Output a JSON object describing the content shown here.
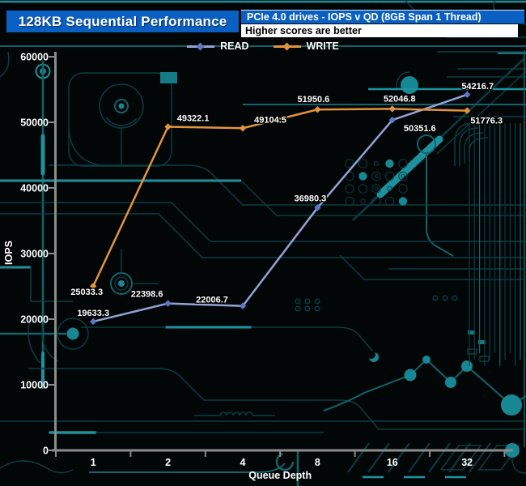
{
  "header": {
    "title": "128KB Sequential Performance",
    "subtitle": "PCIe 4.0 drives - IOPS v QD (8GB Span 1 Thread)",
    "note": "Higher scores are better"
  },
  "colors": {
    "header_bg": "#0a60c2",
    "note_bg": "#ffffff",
    "axis": "#8c8c8c",
    "tick_text": "#ffffff",
    "label_text": "#ffffff",
    "circuit_bright": "#1d929c",
    "circuit_mid": "#11646d",
    "circuit_dim": "#0a3d45",
    "background": "#030606"
  },
  "chart_data": {
    "type": "line",
    "title": "128KB Sequential Performance",
    "categories": [
      "1",
      "2",
      "4",
      "8",
      "16",
      "32"
    ],
    "xlabel": "Queue Depth",
    "ylabel": "IOPS",
    "ylim": [
      0,
      60000
    ],
    "yticks": [
      0,
      10000,
      20000,
      30000,
      40000,
      50000,
      60000
    ],
    "grid": false,
    "legend_position": "top-center",
    "series": [
      {
        "name": "READ",
        "color": "#93a3d6",
        "marker_color": "#5c77c5",
        "values": [
          19633.3,
          22398.6,
          22006.7,
          36980.3,
          50351.6,
          54216.7
        ],
        "point_labels": [
          "19633.3",
          "22398.6",
          "22006.7",
          "36980.3",
          "50351.6",
          "54216.7"
        ],
        "label_offsets": [
          [
            0,
            -7
          ],
          [
            -26,
            -8
          ],
          [
            -38,
            -4
          ],
          [
            -9,
            -8
          ],
          [
            34,
            14
          ],
          [
            13,
            -7
          ]
        ]
      },
      {
        "name": "WRITE",
        "color": "#e2943e",
        "marker_color": "#e2943e",
        "values": [
          25033.3,
          49322.1,
          49104.5,
          51950.6,
          52046.8,
          51776.3
        ],
        "point_labels": [
          "25033.3",
          "49322.1",
          "49104.5",
          "51950.6",
          "52046.8",
          "51776.3"
        ],
        "label_offsets": [
          [
            -8,
            11
          ],
          [
            31,
            -7
          ],
          [
            34,
            -7
          ],
          [
            -5,
            -9
          ],
          [
            9,
            -9
          ],
          [
            24,
            16
          ]
        ]
      }
    ]
  }
}
